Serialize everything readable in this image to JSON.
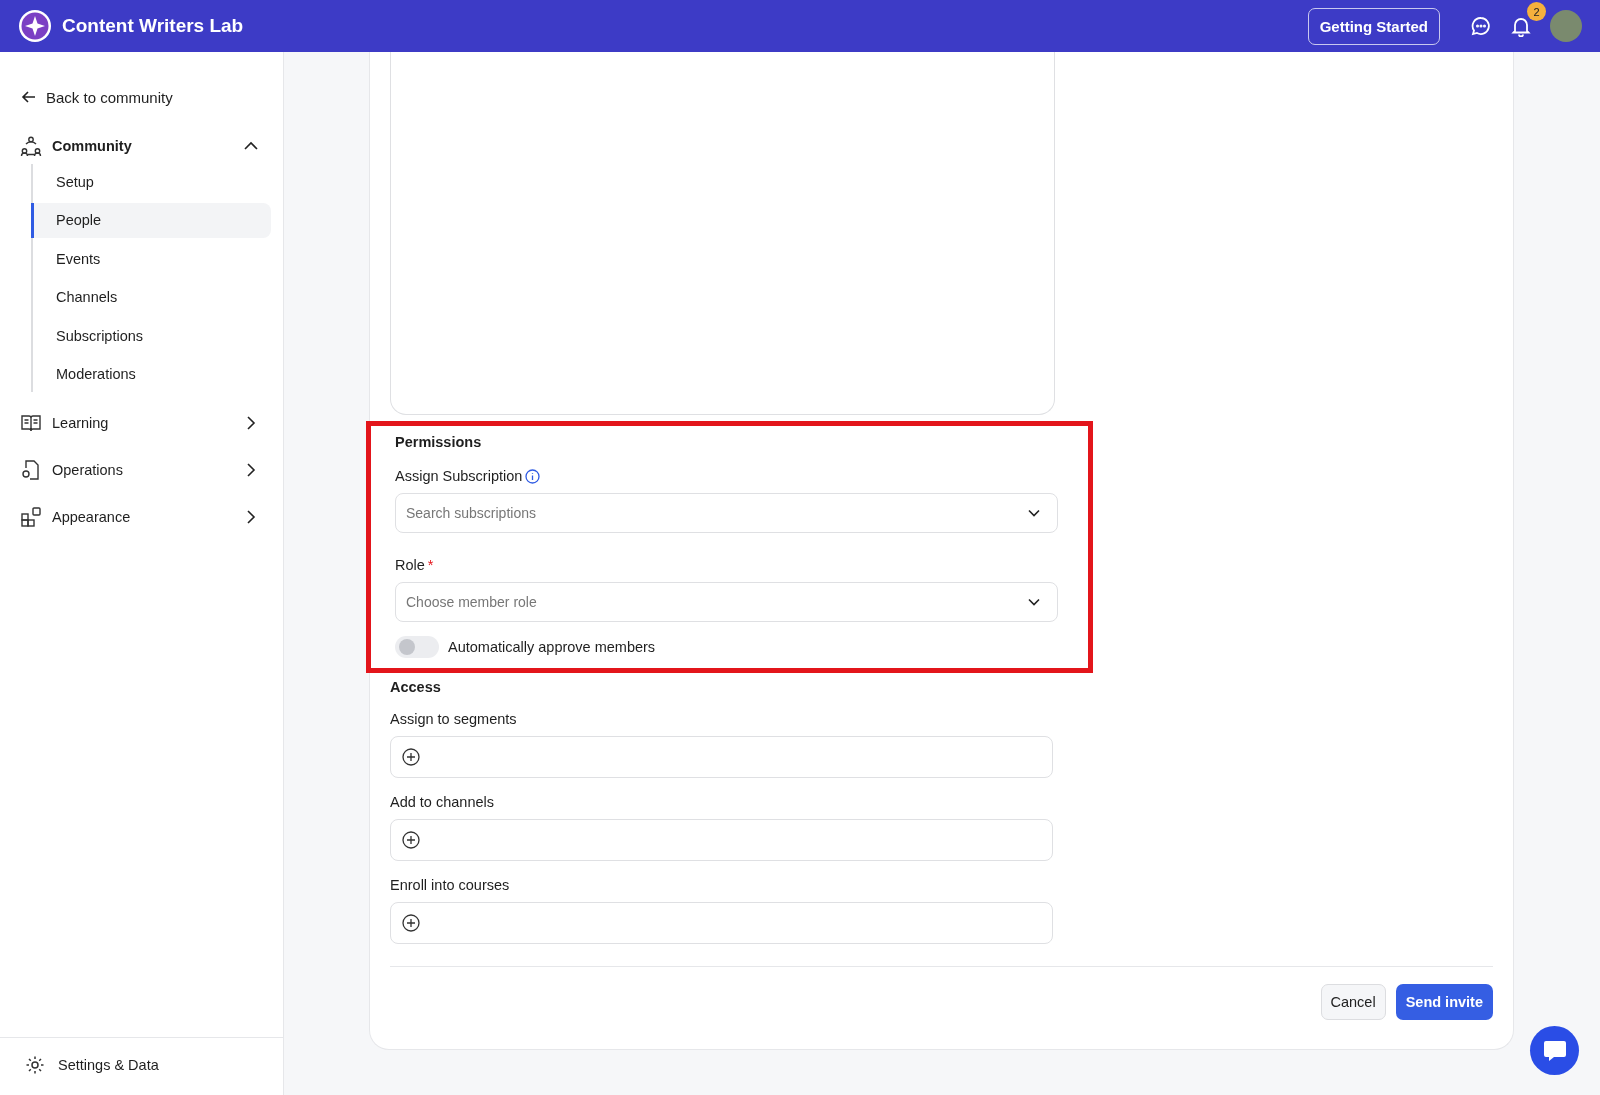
{
  "header": {
    "brand": "Content Writers Lab",
    "getting_started": "Getting Started",
    "notification_count": "2"
  },
  "sidebar": {
    "back": "Back to community",
    "sections": [
      {
        "label": "Community",
        "kind": "people",
        "expanded": true,
        "children": [
          {
            "label": "Setup",
            "selected": false
          },
          {
            "label": "People",
            "selected": true
          },
          {
            "label": "Events",
            "selected": false
          },
          {
            "label": "Channels",
            "selected": false
          },
          {
            "label": "Subscriptions",
            "selected": false
          },
          {
            "label": "Moderations",
            "selected": false
          }
        ]
      },
      {
        "label": "Learning",
        "kind": "book",
        "expanded": false
      },
      {
        "label": "Operations",
        "kind": "doc",
        "expanded": false
      },
      {
        "label": "Appearance",
        "kind": "blocks",
        "expanded": false
      }
    ],
    "settings": "Settings & Data"
  },
  "form": {
    "permissions": {
      "title": "Permissions",
      "highlighted": true,
      "subscription": {
        "label": "Assign Subscription",
        "placeholder": "Search subscriptions"
      },
      "role": {
        "label": "Role",
        "required_mark": "*",
        "placeholder": "Choose member role"
      },
      "auto_approve": {
        "label": "Automatically approve members",
        "on": false
      }
    },
    "access": {
      "title": "Access",
      "fields": [
        {
          "label": "Assign to segments"
        },
        {
          "label": "Add to channels"
        },
        {
          "label": "Enroll into courses"
        }
      ]
    },
    "buttons": {
      "cancel": "Cancel",
      "submit": "Send invite"
    }
  }
}
